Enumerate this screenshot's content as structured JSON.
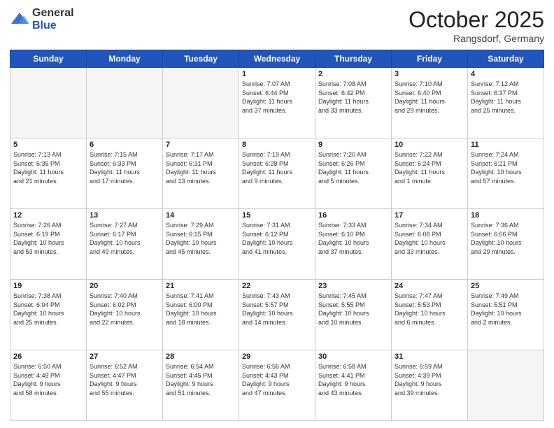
{
  "header": {
    "logo_general": "General",
    "logo_blue": "Blue",
    "title": "October 2025",
    "location": "Rangsdorf, Germany"
  },
  "weekdays": [
    "Sunday",
    "Monday",
    "Tuesday",
    "Wednesday",
    "Thursday",
    "Friday",
    "Saturday"
  ],
  "weeks": [
    [
      {
        "day": "",
        "info": ""
      },
      {
        "day": "",
        "info": ""
      },
      {
        "day": "",
        "info": ""
      },
      {
        "day": "1",
        "info": "Sunrise: 7:07 AM\nSunset: 6:44 PM\nDaylight: 11 hours\nand 37 minutes."
      },
      {
        "day": "2",
        "info": "Sunrise: 7:08 AM\nSunset: 6:42 PM\nDaylight: 11 hours\nand 33 minutes."
      },
      {
        "day": "3",
        "info": "Sunrise: 7:10 AM\nSunset: 6:40 PM\nDaylight: 11 hours\nand 29 minutes."
      },
      {
        "day": "4",
        "info": "Sunrise: 7:12 AM\nSunset: 6:37 PM\nDaylight: 11 hours\nand 25 minutes."
      }
    ],
    [
      {
        "day": "5",
        "info": "Sunrise: 7:13 AM\nSunset: 6:35 PM\nDaylight: 11 hours\nand 21 minutes."
      },
      {
        "day": "6",
        "info": "Sunrise: 7:15 AM\nSunset: 6:33 PM\nDaylight: 11 hours\nand 17 minutes."
      },
      {
        "day": "7",
        "info": "Sunrise: 7:17 AM\nSunset: 6:31 PM\nDaylight: 11 hours\nand 13 minutes."
      },
      {
        "day": "8",
        "info": "Sunrise: 7:19 AM\nSunset: 6:28 PM\nDaylight: 11 hours\nand 9 minutes."
      },
      {
        "day": "9",
        "info": "Sunrise: 7:20 AM\nSunset: 6:26 PM\nDaylight: 11 hours\nand 5 minutes."
      },
      {
        "day": "10",
        "info": "Sunrise: 7:22 AM\nSunset: 6:24 PM\nDaylight: 11 hours\nand 1 minute."
      },
      {
        "day": "11",
        "info": "Sunrise: 7:24 AM\nSunset: 6:21 PM\nDaylight: 10 hours\nand 57 minutes."
      }
    ],
    [
      {
        "day": "12",
        "info": "Sunrise: 7:26 AM\nSunset: 6:19 PM\nDaylight: 10 hours\nand 53 minutes."
      },
      {
        "day": "13",
        "info": "Sunrise: 7:27 AM\nSunset: 6:17 PM\nDaylight: 10 hours\nand 49 minutes."
      },
      {
        "day": "14",
        "info": "Sunrise: 7:29 AM\nSunset: 6:15 PM\nDaylight: 10 hours\nand 45 minutes."
      },
      {
        "day": "15",
        "info": "Sunrise: 7:31 AM\nSunset: 6:12 PM\nDaylight: 10 hours\nand 41 minutes."
      },
      {
        "day": "16",
        "info": "Sunrise: 7:33 AM\nSunset: 6:10 PM\nDaylight: 10 hours\nand 37 minutes."
      },
      {
        "day": "17",
        "info": "Sunrise: 7:34 AM\nSunset: 6:08 PM\nDaylight: 10 hours\nand 33 minutes."
      },
      {
        "day": "18",
        "info": "Sunrise: 7:36 AM\nSunset: 6:06 PM\nDaylight: 10 hours\nand 29 minutes."
      }
    ],
    [
      {
        "day": "19",
        "info": "Sunrise: 7:38 AM\nSunset: 6:04 PM\nDaylight: 10 hours\nand 25 minutes."
      },
      {
        "day": "20",
        "info": "Sunrise: 7:40 AM\nSunset: 6:02 PM\nDaylight: 10 hours\nand 22 minutes."
      },
      {
        "day": "21",
        "info": "Sunrise: 7:41 AM\nSunset: 6:00 PM\nDaylight: 10 hours\nand 18 minutes."
      },
      {
        "day": "22",
        "info": "Sunrise: 7:43 AM\nSunset: 5:57 PM\nDaylight: 10 hours\nand 14 minutes."
      },
      {
        "day": "23",
        "info": "Sunrise: 7:45 AM\nSunset: 5:55 PM\nDaylight: 10 hours\nand 10 minutes."
      },
      {
        "day": "24",
        "info": "Sunrise: 7:47 AM\nSunset: 5:53 PM\nDaylight: 10 hours\nand 6 minutes."
      },
      {
        "day": "25",
        "info": "Sunrise: 7:49 AM\nSunset: 5:51 PM\nDaylight: 10 hours\nand 2 minutes."
      }
    ],
    [
      {
        "day": "26",
        "info": "Sunrise: 6:50 AM\nSunset: 4:49 PM\nDaylight: 9 hours\nand 58 minutes."
      },
      {
        "day": "27",
        "info": "Sunrise: 6:52 AM\nSunset: 4:47 PM\nDaylight: 9 hours\nand 55 minutes."
      },
      {
        "day": "28",
        "info": "Sunrise: 6:54 AM\nSunset: 4:45 PM\nDaylight: 9 hours\nand 51 minutes."
      },
      {
        "day": "29",
        "info": "Sunrise: 6:56 AM\nSunset: 4:43 PM\nDaylight: 9 hours\nand 47 minutes."
      },
      {
        "day": "30",
        "info": "Sunrise: 6:58 AM\nSunset: 4:41 PM\nDaylight: 9 hours\nand 43 minutes."
      },
      {
        "day": "31",
        "info": "Sunrise: 6:59 AM\nSunset: 4:39 PM\nDaylight: 9 hours\nand 39 minutes."
      },
      {
        "day": "",
        "info": ""
      }
    ]
  ]
}
